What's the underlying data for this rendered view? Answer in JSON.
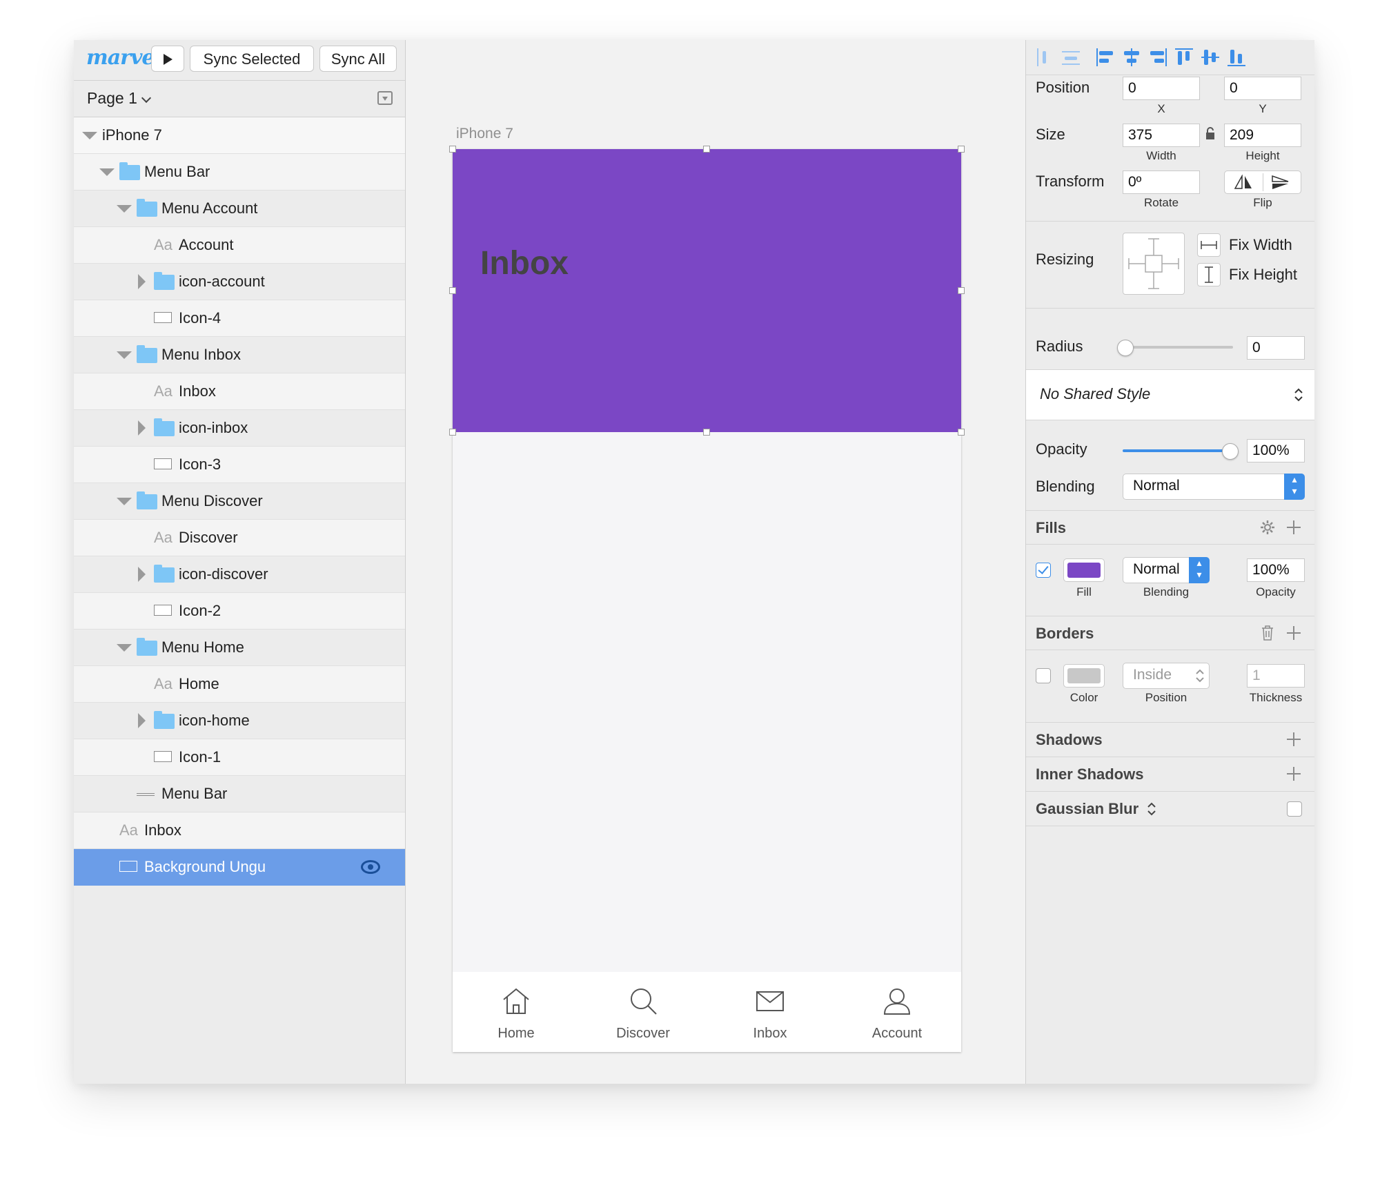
{
  "colors": {
    "accent": "#3c8ee8",
    "fill_purple": "#7b47c5",
    "selected_row": "#6b9de8",
    "folder": "#7ec6f6",
    "border_swatch": "#c8c8c8"
  },
  "toolbar": {
    "logo": "marvel",
    "play_icon": "play-icon",
    "sync_selected": "Sync Selected",
    "sync_all": "Sync All"
  },
  "pagebar": {
    "page": "Page 1"
  },
  "layers": {
    "root": "iPhone 7",
    "items": [
      {
        "label": "Menu Bar",
        "type": "folder",
        "expand": "down"
      },
      {
        "label": "Menu Account",
        "type": "folder",
        "expand": "down"
      },
      {
        "label": "Account",
        "type": "text"
      },
      {
        "label": "icon-account",
        "type": "folder",
        "expand": "right"
      },
      {
        "label": "Icon-4",
        "type": "rect"
      },
      {
        "label": "Menu Inbox",
        "type": "folder",
        "expand": "down"
      },
      {
        "label": "Inbox",
        "type": "text"
      },
      {
        "label": "icon-inbox",
        "type": "folder",
        "expand": "right"
      },
      {
        "label": "Icon-3",
        "type": "rect"
      },
      {
        "label": "Menu Discover",
        "type": "folder",
        "expand": "down"
      },
      {
        "label": "Discover",
        "type": "text"
      },
      {
        "label": "icon-discover",
        "type": "folder",
        "expand": "right"
      },
      {
        "label": "Icon-2",
        "type": "rect"
      },
      {
        "label": "Menu Home",
        "type": "folder",
        "expand": "down"
      },
      {
        "label": "Home",
        "type": "text"
      },
      {
        "label": "icon-home",
        "type": "folder",
        "expand": "right"
      },
      {
        "label": "Icon-1",
        "type": "rect"
      },
      {
        "label": "Menu Bar",
        "type": "line"
      },
      {
        "label": "Inbox",
        "type": "text"
      },
      {
        "label": "Background Ungu",
        "type": "rect",
        "selected": true
      }
    ],
    "text_icon_glyph": "Aa"
  },
  "canvas": {
    "artboard_label": "iPhone 7",
    "title": "Inbox",
    "tabs": [
      {
        "label": "Home",
        "icon": "home-icon"
      },
      {
        "label": "Discover",
        "icon": "search-icon"
      },
      {
        "label": "Inbox",
        "icon": "mail-icon"
      },
      {
        "label": "Account",
        "icon": "user-icon"
      }
    ]
  },
  "inspector": {
    "position": {
      "label": "Position",
      "x": "0",
      "y": "0",
      "x_sub": "X",
      "y_sub": "Y"
    },
    "size": {
      "label": "Size",
      "width": "375",
      "height": "209",
      "width_sub": "Width",
      "height_sub": "Height"
    },
    "transform": {
      "label": "Transform",
      "rotate": "0º",
      "rotate_sub": "Rotate",
      "flip_sub": "Flip"
    },
    "resizing": {
      "label": "Resizing",
      "fix_width": "Fix Width",
      "fix_height": "Fix Height"
    },
    "radius": {
      "label": "Radius",
      "value": "0",
      "slider": 0
    },
    "shared_style": "No Shared Style",
    "opacity": {
      "label": "Opacity",
      "value": "100%",
      "slider": 1.0
    },
    "blending": {
      "label": "Blending",
      "value": "Normal"
    },
    "fills": {
      "header": "Fills",
      "enabled": true,
      "blending": "Normal",
      "opacity": "100%",
      "sub_fill": "Fill",
      "sub_blending": "Blending",
      "sub_opacity": "Opacity"
    },
    "borders": {
      "header": "Borders",
      "enabled": false,
      "position": "Inside",
      "thickness": "1",
      "sub_color": "Color",
      "sub_position": "Position",
      "sub_thickness": "Thickness"
    },
    "shadows": "Shadows",
    "inner_shadows": "Inner Shadows",
    "gaussian_blur": "Gaussian Blur"
  }
}
